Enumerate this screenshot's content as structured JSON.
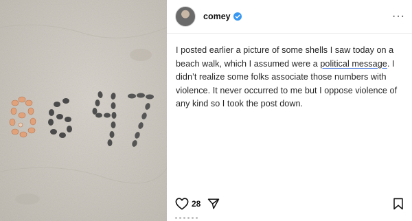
{
  "post": {
    "username": "comey",
    "caption_part1": "I posted earlier a picture of some shells I saw today on a beach walk, which I assumed were a ",
    "caption_link": "political message",
    "caption_part2": ". I didn’t realize some folks associate those numbers with violence. It never occurred to me but I oppose violence of any kind so I took the post down.",
    "likes": "28"
  },
  "photo": {
    "shells_text": "8647"
  },
  "icons": {
    "avatar": "profile-avatar",
    "verified": "verified-badge-icon",
    "more": "more-options-icon",
    "like": "heart-icon",
    "share": "send-icon",
    "save": "bookmark-icon"
  },
  "colors": {
    "verified": "#3897f0",
    "sand": "#cfcac2",
    "stones": "#4a4a4a",
    "shells": "#e0a27a"
  }
}
